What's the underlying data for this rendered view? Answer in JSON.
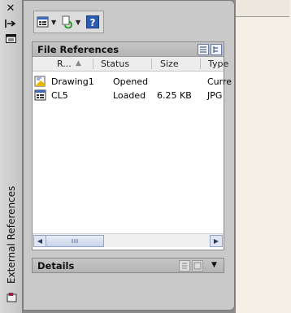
{
  "palette": {
    "title": "External References"
  },
  "file_references": {
    "title": "File References",
    "columns": [
      "R...",
      "Status",
      "Size",
      "Type"
    ],
    "rows": [
      {
        "name": "Drawing1",
        "status": "Opened",
        "size": "",
        "type": "Curre"
      },
      {
        "name": "CL5",
        "status": "Loaded",
        "size": "6.25 KB",
        "type": "JPG"
      }
    ]
  },
  "details": {
    "title": "Details"
  },
  "icons": {
    "close": "close-icon",
    "autohide": "autohide-icon",
    "properties": "properties-icon",
    "attach": "attach-image-icon",
    "refresh": "refresh-icon",
    "help": "help-icon",
    "list_view": "list-view-icon",
    "tree_view": "tree-view-icon",
    "details_toggle": "details-icon",
    "preview_toggle": "preview-icon"
  },
  "colors": {
    "palette_bg": "#c9c9c9",
    "help_blue": "#2a5db0",
    "scroll_thumb": "#c8d3e8"
  }
}
